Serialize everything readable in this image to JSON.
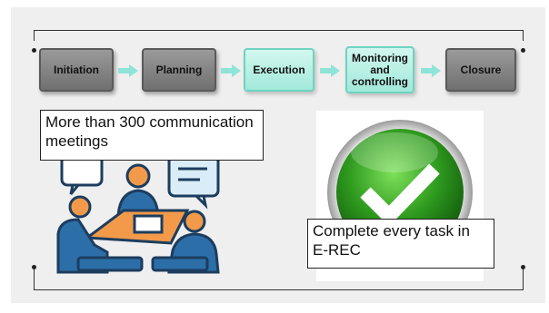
{
  "stages": [
    {
      "label": "Initiation",
      "style": "gray"
    },
    {
      "label": "Planning",
      "style": "gray"
    },
    {
      "label": "Execution",
      "style": "teal"
    },
    {
      "label": "Monitoring and controlling",
      "style": "teal"
    },
    {
      "label": "Closure",
      "style": "gray"
    }
  ],
  "meetings_caption": "More than 300 communication meetings",
  "task_caption": "Complete every task in E-REC",
  "colors": {
    "arrow": "#8fe3d8",
    "check_green": "#2e9a1e",
    "meeting_blue": "#2c6fa8",
    "meeting_orange": "#f29a4a"
  },
  "icons": [
    "meeting-icon",
    "checkmark-icon"
  ]
}
